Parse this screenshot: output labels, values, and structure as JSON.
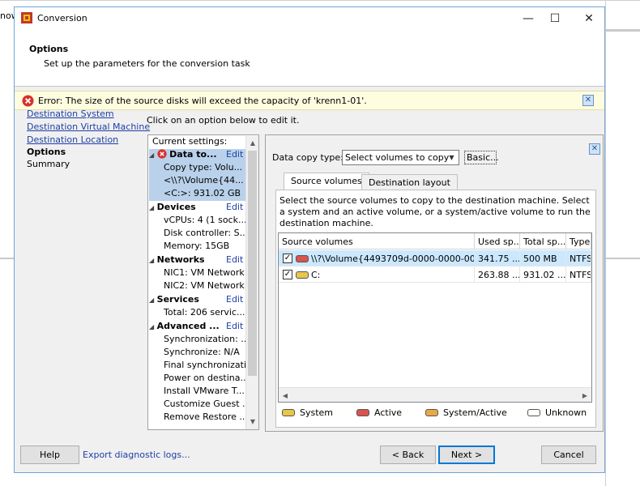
{
  "background": {
    "title_fragment": "now"
  },
  "window": {
    "title": "Conversion",
    "minimize_glyph": "—",
    "maximize_glyph": "☐",
    "close_glyph": "✕"
  },
  "header": {
    "title": "Options",
    "subtitle": "Set up the parameters for the conversion task"
  },
  "error": {
    "text": "Error: The size of the source disks will exceed the capacity of 'krenn1-01'.",
    "close_glyph": "✕"
  },
  "nav": {
    "items": [
      {
        "label": "Destination System",
        "kind": "link"
      },
      {
        "label": "Destination Virtual Machine",
        "kind": "link"
      },
      {
        "label": "Destination Location",
        "kind": "link"
      },
      {
        "label": "Options",
        "kind": "current"
      },
      {
        "label": "Summary",
        "kind": "plain"
      }
    ]
  },
  "instructions": "Click on an option below to edit it.",
  "settings": {
    "header": "Current settings:",
    "edit_label": "Edit",
    "groups": [
      {
        "name": "Data to...",
        "rows": [
          "Copy type: Volu...",
          "<\\\\?\\Volume{44...",
          "<C:>: 931.02 GB"
        ]
      },
      {
        "name": "Devices",
        "rows": [
          "vCPUs: 4 (1 sock...",
          "Disk controller: S...",
          "Memory: 15GB"
        ]
      },
      {
        "name": "Networks",
        "rows": [
          "NIC1: VM Network",
          "NIC2: VM Network"
        ]
      },
      {
        "name": "Services",
        "rows": [
          "Total: 206 servic..."
        ]
      },
      {
        "name": "Advanced ...",
        "rows": [
          "Synchronization: ...",
          "Synchronize: N/A",
          "Final synchronizati...",
          "Power on destina...",
          "Install VMware T...",
          "Customize Guest ...",
          "Remove Restore ..."
        ]
      }
    ]
  },
  "data_copy": {
    "label": "Data copy type:",
    "value": "Select volumes to copy",
    "basic_button": "Basic..."
  },
  "tabs": [
    "Source volumes",
    "Destination layout"
  ],
  "description": "Select the source volumes to copy to the destination machine. Select a system and an active volume, or a system/active volume to run the destination machine.",
  "volumes_table": {
    "columns": [
      "Source volumes",
      "Used sp...",
      "Total sp...",
      "Type"
    ],
    "rows": [
      {
        "checked": true,
        "disk": "active",
        "name": "\\\\?\\Volume{4493709d-0000-0000-00...",
        "used": "341.75 ...",
        "total": "500 MB",
        "type": "NTFS"
      },
      {
        "checked": true,
        "disk": "system",
        "name": "C:",
        "used": "263.88 ...",
        "total": "931.02 ...",
        "type": "NTFS"
      }
    ]
  },
  "legend": [
    {
      "label": "System",
      "color": "#e8c64a"
    },
    {
      "label": "Active",
      "color": "#d9534f"
    },
    {
      "label": "System/Active",
      "color": "#e8a84a"
    },
    {
      "label": "Unknown",
      "color": "#ffffff"
    }
  ],
  "footer": {
    "help": "Help",
    "export": "Export diagnostic logs...",
    "back": "< Back",
    "next": "Next >",
    "cancel": "Cancel"
  },
  "colors": {
    "link": "#1d3fa6",
    "selection": "#b9d1ea",
    "error_bar": "#fefde0",
    "error_icon": "#d9312a"
  }
}
